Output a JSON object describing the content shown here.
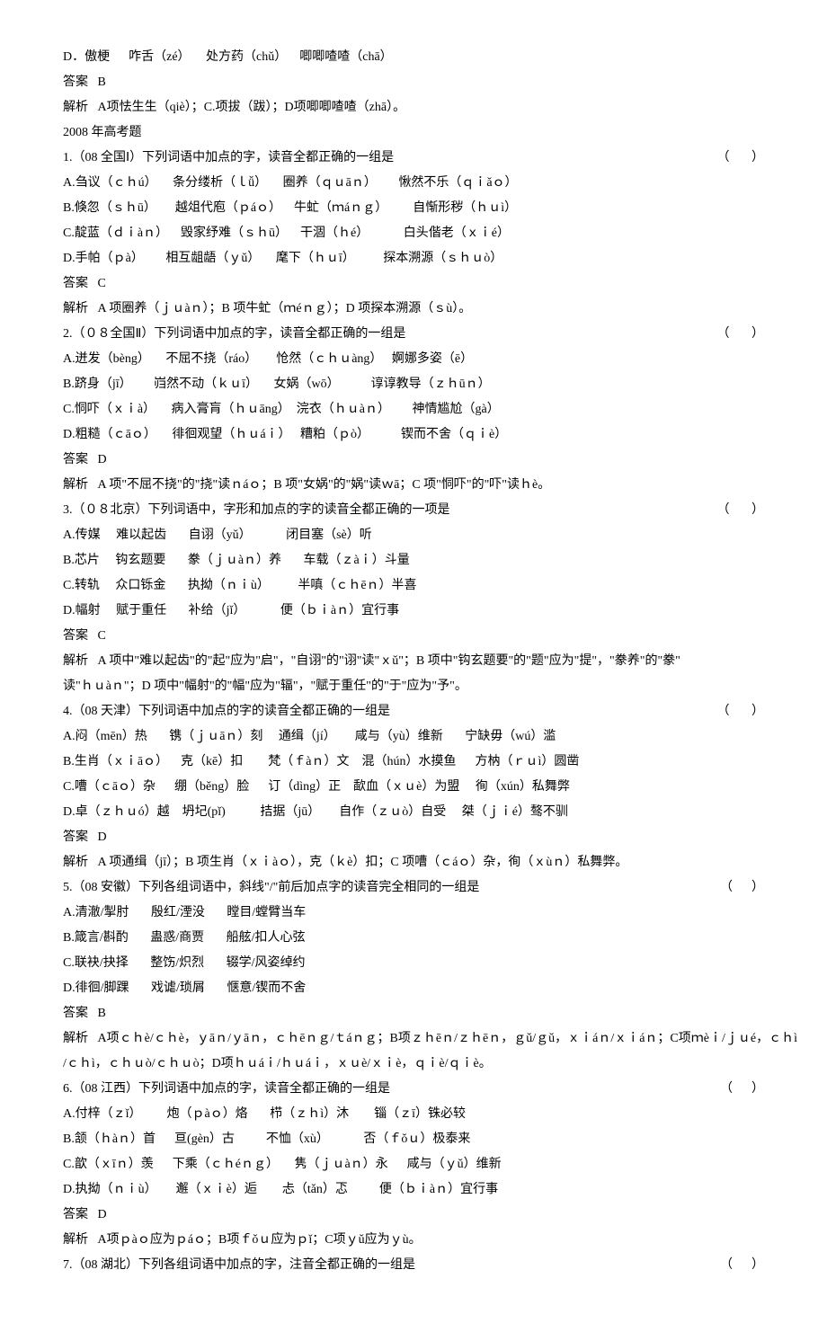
{
  "lines": [
    {
      "text": "D．傲梗      咋舌（zé）     处方药（chǔ）    唧唧喳喳（chā）"
    },
    {
      "text": "答案   B"
    },
    {
      "text": "解析   A项怯生生（qiè）；C.项拔（跋）；D项唧唧喳喳（zhā）。"
    },
    {
      "text": "2008 年高考题"
    },
    {
      "text": "1.（08 全国Ⅰ）下列词语中加点的字，读音全都正确的一组是",
      "bracket": "（       ）"
    },
    {
      "text": "A.刍议（ｃｈú）     条分缕析（ｌǚ）     圈养（ｑｕāｎ）       愀然不乐（ｑｉǎｏ）"
    },
    {
      "text": "B.倏忽（ｓｈū）      越俎代庖（ｐáｏ）    牛虻（ｍáｎｇ）        自惭形秽（ｈｕì）"
    },
    {
      "text": "C.靛蓝（ｄｉàｎ）    毁家纾难（ｓｈū）    干涸（ｈé）           白头偕老（ｘｉé）"
    },
    {
      "text": "D.手帕（ｐà）       相互龃龉（ｙǔ）     麾下（ｈｕī）         探本溯源（ｓｈｕò）"
    },
    {
      "text": "答案   C"
    },
    {
      "text": "解析   A 项圈养（ｊｕàｎ）；B 项牛虻（ｍéｎｇ）；D 项探本溯源（ｓù）。"
    },
    {
      "text": "2.（０８全国Ⅱ）下列词语中加点的字，读音全都正确的一组是",
      "bracket": "（       ）"
    },
    {
      "text": "A.迸发（bèng）     不屈不挠（ráo）      怆然（ｃｈｕàng）   婀娜多姿（ē）"
    },
    {
      "text": "B.跻身（jī）       岿然不动（ｋｕī）     女娲（wō）          谆谆教导（ｚｈūｎ）"
    },
    {
      "text": "C.恫吓（ｘｉà）     病入膏肓（ｈｕāng）  浣衣（ｈｕàｎ）       神情尴尬（gà）"
    },
    {
      "text": "D.粗糙（ｃāｏ）     徘徊观望（ｈｕáｉ）   糟粕（ｐò）          锲而不舍（ｑｉè）"
    },
    {
      "text": "答案   D"
    },
    {
      "text": "解析   A 项\"不屈不挠\"的\"挠\"读ｎáｏ；B 项\"女娲\"的\"娲\"读ｗā；C 项\"恫吓\"的\"吓\"读ｈè。"
    },
    {
      "text": "3.（０８北京）下列词语中，字形和加点的字的读音全都正确的一项是",
      "bracket": "（       ）"
    },
    {
      "text": "A.传媒     难以起齿       自诩（yǔ）           闭目塞（sè）听"
    },
    {
      "text": "B.芯片     钩玄题要       豢（ｊｕàｎ）养       车载（ｚàｉ）斗量"
    },
    {
      "text": "C.转轨     众口铄金       执拗（ｎｉù）         半嗔（ｃｈēｎ）半喜"
    },
    {
      "text": "D.幅射     赋于重任       补给（jǐ）           便（ｂｉàｎ）宜行事"
    },
    {
      "text": "答案   C"
    },
    {
      "text": "解析   A 项中\"难以起齿\"的\"起\"应为\"启\"，\"自诩\"的\"诩\"读\"ｘǔ\"；B 项中\"钩玄题要\"的\"题\"应为\"提\"，\"豢养\"的\"豢\""
    },
    {
      "text": "读\"ｈｕàｎ\"；D 项中\"幅射\"的\"幅\"应为\"辐\"，\"赋于重任\"的\"于\"应为\"予\"。"
    },
    {
      "text": "4.（08 天津）下列词语中加点的字的读音全都正确的一组是",
      "bracket": "（       ）"
    },
    {
      "text": "A.闷（mēn）热       镌（ｊｕāｎ）刻     通缉（jí）      咸与（yù）维新       宁缺毋（wú）滥"
    },
    {
      "text": "B.生肖（ｘｉāｏ）    克（kē）扣        梵（ｆàｎ）文    混（hún）水摸鱼      方枘（ｒｕì）圆凿"
    },
    {
      "text": "C.嘈（ｃāｏ）杂      绷（běng）脸      订（dìng）正    歃血（ｘｕè）为盟     徇（xún）私舞弊"
    },
    {
      "text": "D.卓（ｚｈｕó）越    坍圮(pǐ)           拮据（jū）      自作（ｚｕò）自受     桀（ｊｉé）骜不驯"
    },
    {
      "text": "答案   D"
    },
    {
      "text": "解析   A 项通缉（jī）；B 项生肖（ｘｉàｏ），克（ｋè）扣；C 项嘈（ｃáｏ）杂，徇（ｘùｎ）私舞弊。"
    },
    {
      "text": "5.（08 安徽）下列各组词语中，斜线\"/\"前后加点字的读音完全相同的一组是",
      "bracket": "（      ）"
    },
    {
      "text": "A.清澈/掣肘       殷红/湮没       瞠目/螳臂当车"
    },
    {
      "text": "B.箴言/斟酌       蛊惑/商贾       船舷/扣人心弦"
    },
    {
      "text": "C.联袂/抉择       整饬/炽烈       辍学/风姿绰约"
    },
    {
      "text": "D.徘徊/脚踝       戏谑/琐屑       惬意/锲而不舍"
    },
    {
      "text": "答案   B"
    },
    {
      "text": "解析   A项ｃｈè/ｃｈè，ｙāｎ/ｙāｎ，ｃｈēｎｇ/ｔáｎｇ；B项ｚｈēｎ/ｚｈēｎ，ｇǔ/ｇǔ，ｘｉáｎ/ｘｉáｎ；C项ｍèｉ/ｊｕé，ｃｈì"
    },
    {
      "text": "/ｃｈì，ｃｈｕò/ｃｈｕò；D项ｈｕáｉ/ｈｕáｉ，ｘｕè/ｘｉè，ｑｉè/ｑｉè。"
    },
    {
      "text": "6.（08 江西）下列词语中加点的字，读音全都正确的一组是",
      "bracket": "（      ）"
    },
    {
      "text": "A.付梓（ｚǐ）        炮（ｐàｏ）烙       栉（ｚｈì）沐        锱（ｚī）铢必较"
    },
    {
      "text": "B.颔（ｈàｎ）首      亘(gèn）古          不恤（xù）           否（ｆǒｕ）极泰来"
    },
    {
      "text": "C.歆（ｘīｎ）羡      下乘（ｃｈéｎｇ）     隽（ｊｕàｎ）永      咸与（ｙǔ）维新"
    },
    {
      "text": "D.执拗（ｎｉù）      邂（ｘｉè）逅        忐（tǎn）忑          便（ｂｉàｎ）宜行事"
    },
    {
      "text": "答案   D"
    },
    {
      "text": "解析   A项ｐàｏ应为ｐáｏ；B项ｆǒｕ应为ｐǐ；C项ｙǔ应为ｙù。"
    },
    {
      "text": "7.（08 湖北）下列各组词语中加点的字，注音全都正确的一组是",
      "bracket": "（      ）"
    }
  ]
}
